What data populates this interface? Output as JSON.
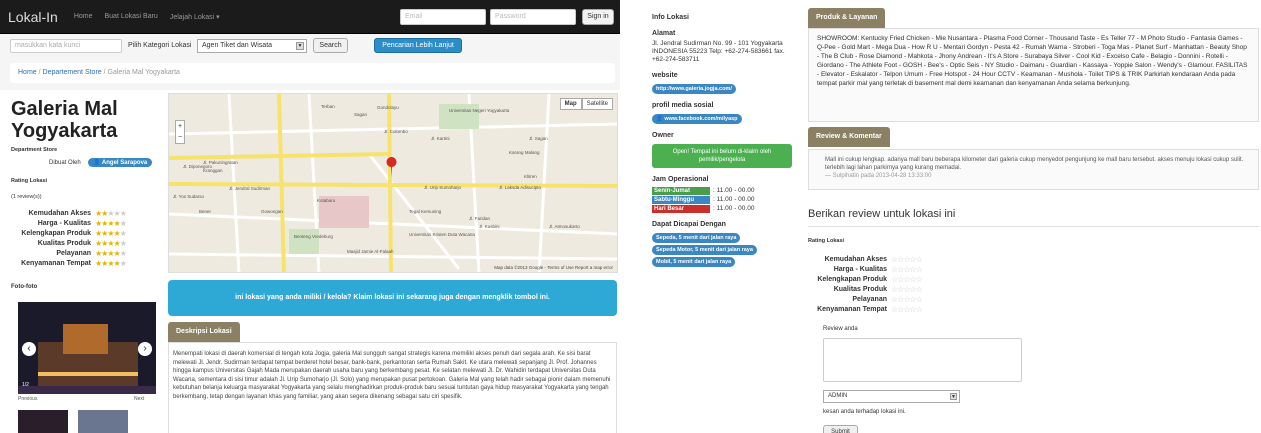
{
  "navbar": {
    "brand": "Lokal-In",
    "links": [
      "Home",
      "Buat Lokasi Baru",
      "Jelajah Lokasi ▾"
    ],
    "email_placeholder": "Email",
    "password_placeholder": "Password",
    "signin": "Sign in"
  },
  "search": {
    "placeholder": "masukkan kata kunci",
    "category_label": "Pilih Kategori Lokasi",
    "category_value": "Agen Tiket dan Wisata",
    "search_button": "Search",
    "advanced_button": "Pencarian Lebih Lanjut"
  },
  "breadcrumb": [
    "Home",
    "Departement Store",
    "Galeria Mal Yogyakarta"
  ],
  "place": {
    "title": "Galeria Mal Yogyakarta",
    "category": "Department Store",
    "created_by_label": "Dibuat Oleh",
    "author": "Angel Sarapova",
    "rating_title": "Rating Lokasi",
    "review_count": "(1 review(s))",
    "ratings": [
      {
        "name": "Kemudahan Akses",
        "stars": 2
      },
      {
        "name": "Harga - Kualitas",
        "stars": 4
      },
      {
        "name": "Kelengkapan Produk",
        "stars": 4
      },
      {
        "name": "Kualitas Produk",
        "stars": 4
      },
      {
        "name": "Pelayanan",
        "stars": 4
      },
      {
        "name": "Kenyamanan Tempat",
        "stars": 4
      }
    ]
  },
  "map": {
    "map_button": "Map",
    "satellite_button": "Satellite",
    "attribution": "Map data ©2013 Google - Terms of Use Report a map error",
    "labels": [
      "Jl. Diponegoro",
      "Jl. Jendral Sudirman",
      "Jl. Urip Sumoharjo",
      "Jl. Laksda Adisucipto",
      "Jl. Pakuningratan",
      "Kranggan",
      "Gondolayu",
      "Terban",
      "Universitas Negeri Yogyakarta",
      "Jl. Colombo",
      "Jl. Kartini",
      "Karang Malang",
      "Sagan",
      "Klitren",
      "Tegal Kemuning",
      "Bener",
      "Gowongan",
      "Jl. Yos Sudarso",
      "Benteng Vredeburg",
      "Kotabaru",
      "Jl. Faridan",
      "Universitas Kristen Duta Wacana",
      "Jl. Kusbini",
      "Jl. Atmosukarto",
      "Masjid Jamie Al-Falaah",
      "Jl. Sagan"
    ]
  },
  "claim_banner": "ini lokasi yang anda miliki / kelola? Klaim lokasi ini sekarang juga dengan mengklik tombol ini.",
  "photos_title": "Foto-foto",
  "carousel": {
    "prev": "Previous",
    "next": "Next",
    "counter": "1/2"
  },
  "description": {
    "title": "Deskripsi Lokasi",
    "text": "Menempati lokasi di daerah komersial di tengah kota Jogja, galeria Mal sungguh sangat strategis karena memiliki akses penuh dari segala arah. Ke sisi barat melewati Jl. Jendr. Sudirman terdapat tempat berderet hotel besar, bank-bank, perkantoran serta Rumah Sakit. Ke utara melewati sepanjang Jl. Prof. Johannes hingga kampus Universitas Gajah Mada merupakan daerah usaha baru yang berkembang pesat. Ke selatan melewati Jl. Dr. Wahidin terdapat Universitas Duta Wacana, sementara di sisi timur adalah Jl. Urip Sumoharjo (Jl. Solo) yang merupakan pusat pertokoan. Galeria Mal yang telah hadir sebagai pionir dalam memenuhi kebutuhan belanja keluarga masyarakat Yogyakarta yang selalu menghadirkan produk-produk baru sesuai tuntutan gaya hidup masyarakat Yogyakarta yang tengah berkembang, tetap dengan layanan khas yang familiar, yang akan segera dikenang sebagai satu ciri spesifik."
  },
  "info": {
    "title": "Info Lokasi",
    "address_label": "Alamat",
    "address": "Jl. Jendral Sudirman No. 99 - 101 Yogyakarta INDONESIA 55223 Telp: +62-274-583661 fax. +62-274-583711",
    "website_label": "website",
    "website": "http://www.galeria.jogja.com/",
    "social_label": "profil media sosial",
    "social": "www.facebook.com/milyasp",
    "owner_label": "Owner",
    "owner_button": "Open! Tempat ini belum di-klaim oleh pemilik/pengelola",
    "hours_label": "Jam Operasional",
    "hours": [
      {
        "day": "Senin-Jumat",
        "time": ": 11.00 - 00.00",
        "color": "#4a9e4a"
      },
      {
        "day": "Sabtu-Minggu",
        "time": ": 11.00 - 00.00",
        "color": "#3a87c2"
      },
      {
        "day": "Hari Besar",
        "time": ": 11.00 - 00.00",
        "color": "#c9302c"
      }
    ],
    "reach_label": "Dapat Dicapai Dengan",
    "reach": [
      "Sepeda, 5 menit dari jalan raya",
      "Sepeda Motor, 5 menit dari jalan raya",
      "Mobil, 5 menit dari jalan raya"
    ]
  },
  "produk": {
    "title": "Produk & Layanan",
    "text": "SHOWROOM: Kentucky Fried Chicken - Mie Nusantara - Plasma Food Corner - Thousand Taste - Es Teller 77 - M Photo Studio - Fantasia Games - Q-Pee - Gold Mart - Mega Dua - How R U - Mentari Gordyn - Pesta 42 - Rumah Warna - Stroberi - Toga Mas - Planet Surf - Manhattan - Beauty Shop - The B Club - Rose Diamond - Mahkota - Jhony Andrean - It's A Store - Surabaya Silver - Cool Kid - Excelso Cafe - Belagio - Donnini - Rotelli - Giordano - The Athlete Foot - GOSH - Bee's - Optic Seis - NY Studio - Daimaru - Guardian - Kassaya - Yoppie Salon - Wendy's - Glamour. FASILITAS - Elevator - Eskalator - Telpon Umum - Free Hotspot - 24 Hour CCTV - Keamanan - Mushola - Toilet TIPS & TRIK Parkirlah kendaraan Anda pada tempat parkir mal yang terletak di basement mal demi keamanan dan kenyamanan Anda selama berkunjung."
  },
  "review": {
    "title": "Review & Komentar",
    "text": "Mall ini cukup lengkap. adanya mall baru beberapa kilometer dari galeria cukup menyedot pengunjung ke mall baru tersebut. akses menuju lokasi cukup sulit. terlebih lagi lahan parkirnya yang kurang memadai.",
    "meta": "— Sulpihatin pada 2013-04-28 13:33:00"
  },
  "form": {
    "title": "Berikan review untuk lokasi ini",
    "rating_title": "Rating Lokasi",
    "ratings": [
      "Kemudahan Akses",
      "Harga - Kualitas",
      "Kelengkapan Produk",
      "Kualitas Produk",
      "Pelayanan",
      "Kenyamanan Tempat"
    ],
    "review_label": "Review anda",
    "select_value": "ADMIN",
    "impression_label": "kesan anda terhadap lokasi ini.",
    "submit": "Submit"
  },
  "colors": {
    "accent": "#3a87c2",
    "section_head": "#8b8063",
    "claim": "#2ea9d6",
    "owner": "#4caf50"
  }
}
